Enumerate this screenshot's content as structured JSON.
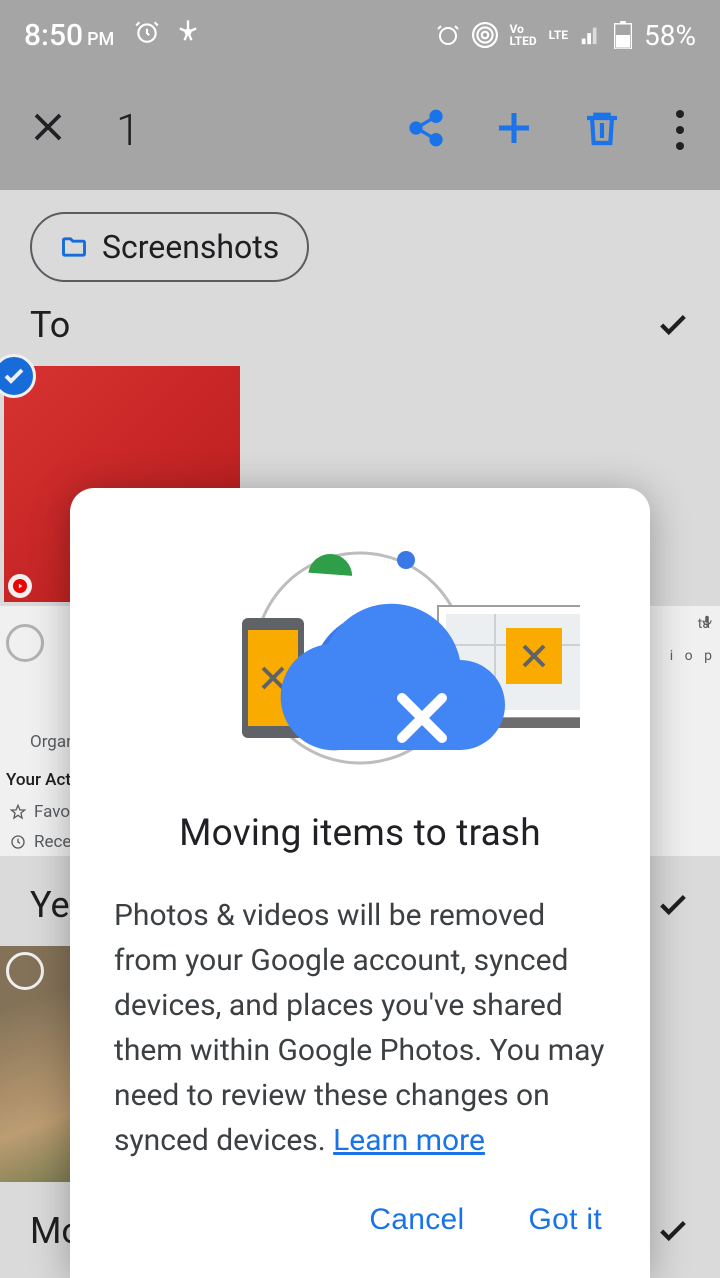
{
  "status": {
    "time": "8:50",
    "period": "PM",
    "battery": "58%"
  },
  "appbar": {
    "count": "1"
  },
  "filter": {
    "label": "Screenshots"
  },
  "sections": {
    "today": "To",
    "yesterday": "Ye",
    "more": "Mo"
  },
  "dialog": {
    "title": "Moving items to trash",
    "body": "Photos & videos will be removed from your Google account, synced devices, and places you've shared them within Google Photos. You may need to review these changes on synced devices. ",
    "learn_more": "Learn more",
    "cancel": "Cancel",
    "got_it": "Got it"
  },
  "misc": {
    "organize": "Organi",
    "activity": "Your Activit",
    "favorite": "Favorit",
    "recent": "Recent",
    "ta": "ta"
  }
}
